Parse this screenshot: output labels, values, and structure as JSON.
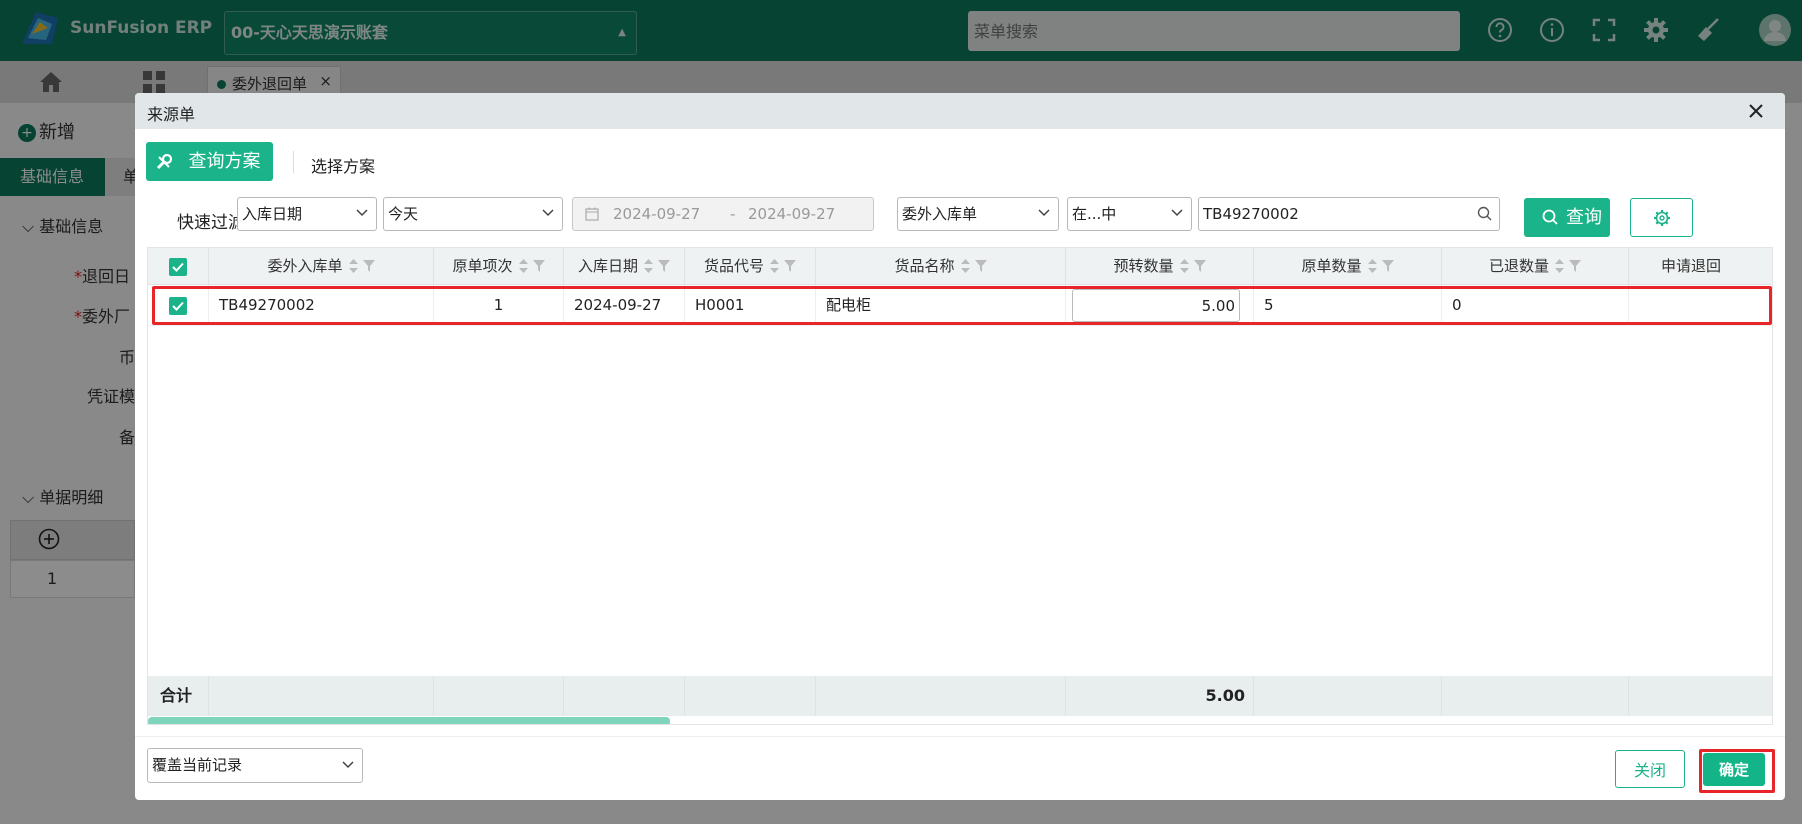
{
  "app": {
    "brand": "SunFusion ERP",
    "account": "00-天心天思演示账套",
    "menu_search_placeholder": "菜单搜索",
    "open_tab": "委外退回单",
    "accent": "#0b7a5e"
  },
  "background": {
    "new_label": "新增",
    "tab_basic": "基础信息",
    "tab_second": "单",
    "section_basic": "基础信息",
    "labels": [
      "退回日",
      "委外厂",
      "币",
      "凭证模",
      "备"
    ],
    "section_detail": "单据明细",
    "detail_row_index": "1"
  },
  "modal": {
    "title": "来源单",
    "query_plan_label": "查询方案",
    "choose_plan_label": "选择方案",
    "filter": {
      "label": "快速过滤",
      "field_select": "入库日期",
      "period_select": "今天",
      "date_from": "2024-09-27",
      "date_sep": "-",
      "date_to": "2024-09-27",
      "doc_type_select": "委外入库单",
      "operator_select": "在...中",
      "keyword_value": "TB49270002",
      "query_label": "查询"
    },
    "grid": {
      "columns": [
        "委外入库单",
        "原单项次",
        "入库日期",
        "货品代号",
        "货品名称",
        "预转数量",
        "原单数量",
        "已退数量",
        "申请退回"
      ],
      "rows": [
        {
          "doc_no": "TB49270002",
          "line_no": "1",
          "in_date": "2024-09-27",
          "item_code": "H0001",
          "item_name": "配电柜",
          "transfer_qty": "5.00",
          "orig_qty": "5",
          "returned_qty": "0"
        }
      ],
      "footer_label": "合计",
      "footer_transfer_total": "5.00"
    },
    "mode_select": "覆盖当前记录",
    "close_label": "关闭",
    "ok_label": "确定",
    "highlight_color": "#e8262a"
  }
}
